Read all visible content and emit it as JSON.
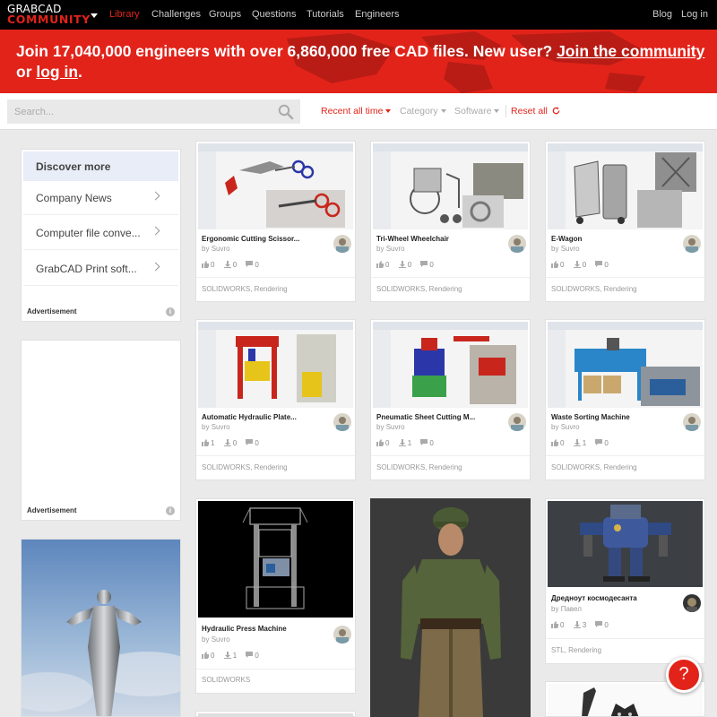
{
  "brand": {
    "line1": "GRABCAD",
    "line2": "COMMUNITY"
  },
  "nav": {
    "links": [
      "Library",
      "Challenges",
      "Groups",
      "Questions",
      "Tutorials",
      "Engineers"
    ],
    "blog": "Blog",
    "login": "Log in"
  },
  "banner": {
    "text": "Join 17,040,000 engineers with over 6,860,000 free CAD files. New user?",
    "join_link": "Join the community",
    "or": "or",
    "login_link": "log in",
    "end": "."
  },
  "search": {
    "placeholder": "Search..."
  },
  "filters": {
    "time": "Recent all time",
    "category": "Category",
    "software": "Software",
    "reset": "Reset all"
  },
  "sidebar": {
    "heading": "Discover more",
    "items": [
      "Company News",
      "Computer file conve...",
      "GrabCAD Print soft..."
    ],
    "ad_label": "Advertisement"
  },
  "cards": [
    {
      "title": "Ergonomic Cutting Scissor...",
      "by": "by",
      "author": "Suvro",
      "likes": "0",
      "downloads": "0",
      "comments": "0",
      "tags": "SOLIDWORKS, Rendering"
    },
    {
      "title": "Tri-Wheel Wheelchair",
      "by": "by",
      "author": "Suvro",
      "likes": "0",
      "downloads": "0",
      "comments": "0",
      "tags": "SOLIDWORKS, Rendering"
    },
    {
      "title": "E-Wagon",
      "by": "by",
      "author": "Suvro",
      "likes": "0",
      "downloads": "0",
      "comments": "0",
      "tags": "SOLIDWORKS, Rendering"
    },
    {
      "title": "Automatic Hydraulic Plate...",
      "by": "by",
      "author": "Suvro",
      "likes": "1",
      "downloads": "0",
      "comments": "0",
      "tags": "SOLIDWORKS, Rendering"
    },
    {
      "title": "Pneumatic Sheet Cutting M...",
      "by": "by",
      "author": "Suvro",
      "likes": "0",
      "downloads": "1",
      "comments": "0",
      "tags": "SOLIDWORKS, Rendering"
    },
    {
      "title": "Waste Sorting Machine",
      "by": "by",
      "author": "Suvro",
      "likes": "0",
      "downloads": "1",
      "comments": "0",
      "tags": "SOLIDWORKS, Rendering"
    },
    {
      "title": "Hydraulic Press Machine",
      "by": "by",
      "author": "Suvro",
      "likes": "0",
      "downloads": "1",
      "comments": "0",
      "tags": "SOLIDWORKS"
    },
    {
      "title": "Дредноут космодесанта",
      "by": "by",
      "author": "Павел",
      "likes": "0",
      "downloads": "3",
      "comments": "0",
      "tags": "STL, Rendering"
    }
  ],
  "help": {
    "label": "?"
  },
  "colors": {
    "brand_red": "#e2231a",
    "nav_bg": "#000000",
    "page_bg": "#eaeaea"
  }
}
